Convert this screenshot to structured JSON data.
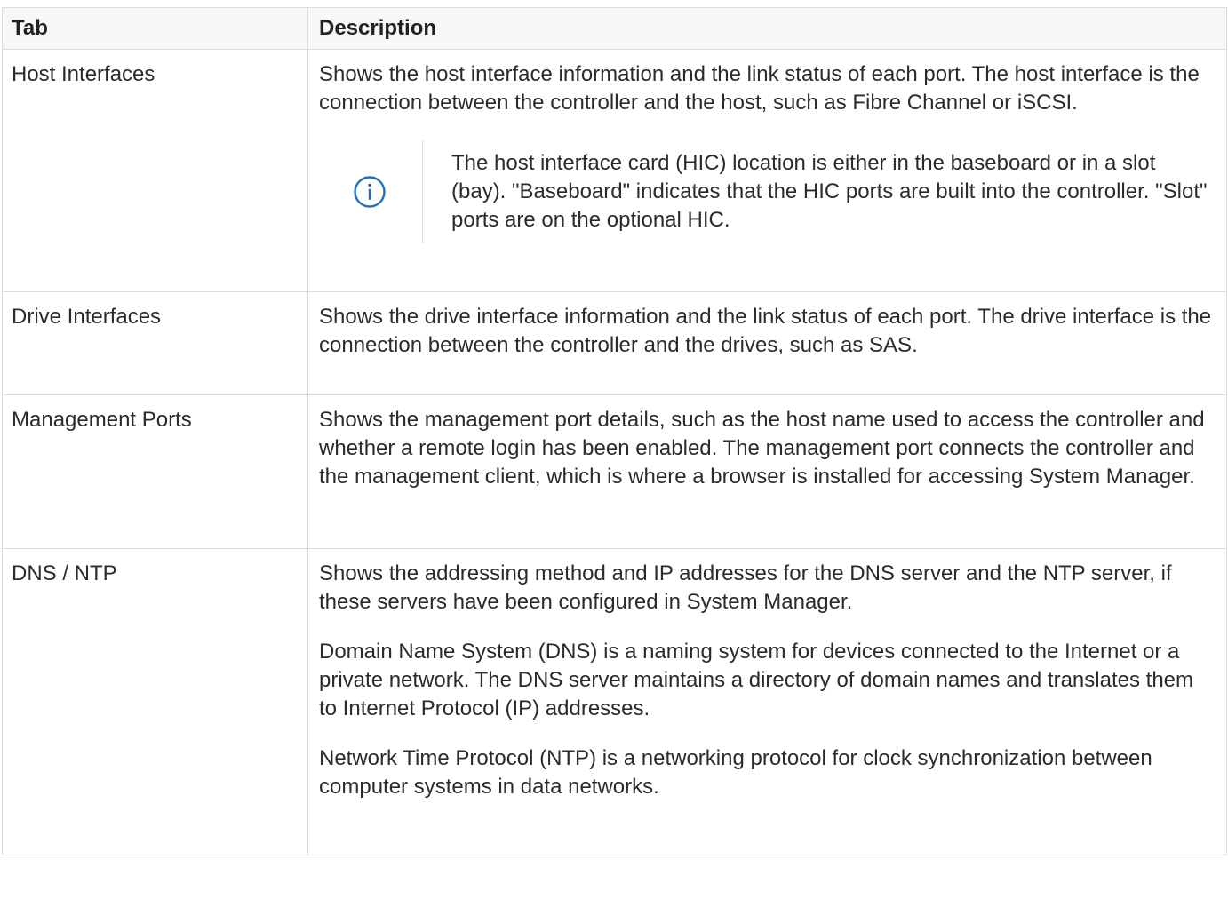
{
  "table": {
    "headers": {
      "tab": "Tab",
      "description": "Description"
    },
    "rows": [
      {
        "tab": "Host Interfaces",
        "paragraphs": [
          "Shows the host interface information and the link status of each port. The host interface is the connection between the controller and the host, such as Fibre Channel or iSCSI."
        ],
        "note": {
          "icon": "info-icon",
          "text": "The host interface card (HIC) location is either in the baseboard or in a slot (bay). \"Baseboard\" indicates that the HIC ports are built into the controller. \"Slot\" ports are on the optional HIC."
        }
      },
      {
        "tab": "Drive Interfaces",
        "paragraphs": [
          "Shows the drive interface information and the link status of each port. The drive interface is the connection between the controller and the drives, such as SAS."
        ]
      },
      {
        "tab": "Management Ports",
        "paragraphs": [
          "Shows the management port details, such as the host name used to access the controller and whether a remote login has been enabled. The management port connects the controller and the management client, which is where a browser is installed for accessing System Manager."
        ]
      },
      {
        "tab": "DNS / NTP",
        "paragraphs": [
          "Shows the addressing method and IP addresses for the DNS server and the NTP server, if these servers have been configured in System Manager.",
          "Domain Name System (DNS) is a naming system for devices connected to the Internet or a private network. The DNS server maintains a directory of domain names and translates them to Internet Protocol (IP) addresses.",
          "Network Time Protocol (NTP) is a networking protocol for clock synchronization between computer systems in data networks."
        ]
      }
    ]
  },
  "colors": {
    "border": "#dcdcdc",
    "header_bg": "#f7f7f7",
    "text": "#2b2b2b",
    "info_icon": "#1f6fb2"
  }
}
